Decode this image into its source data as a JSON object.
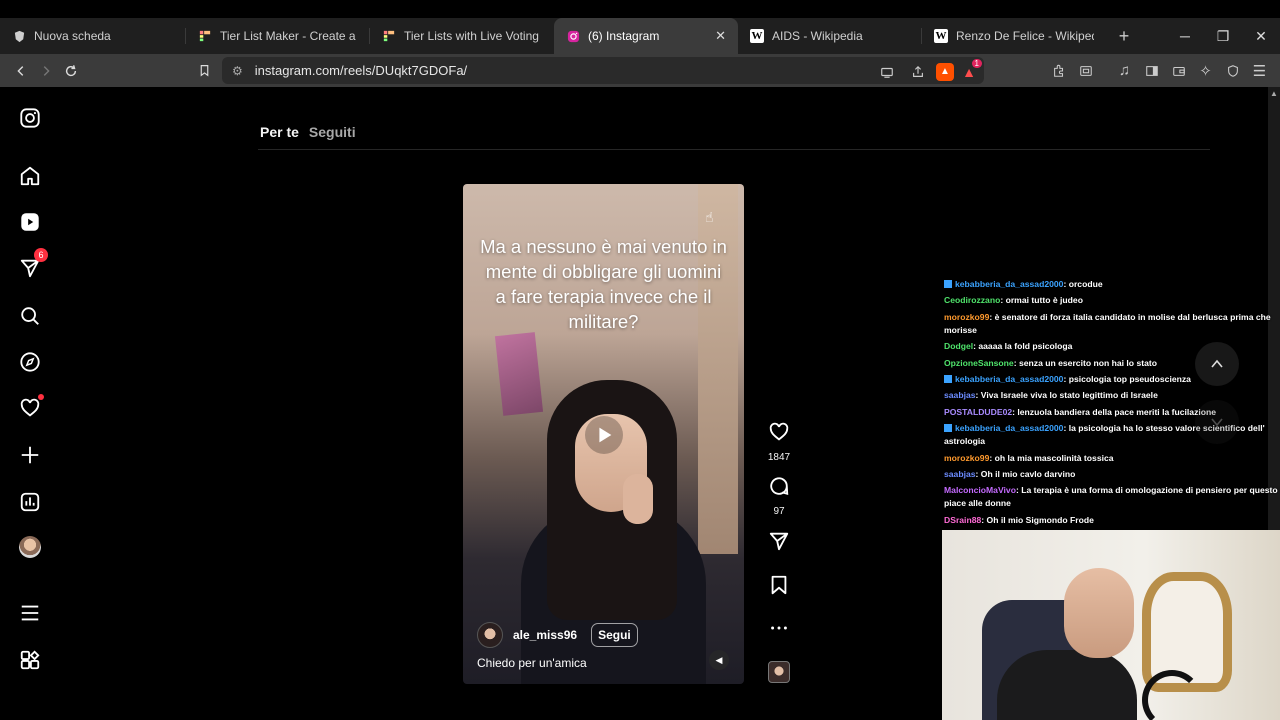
{
  "browser": {
    "tabs": [
      {
        "title": "Nuova scheda",
        "icon": "brave-lion-icon",
        "active": false
      },
      {
        "title": "Tier List Maker - Create a Tier Li",
        "icon": "tiermaker-icon",
        "active": false
      },
      {
        "title": "Tier Lists with Live Voting - TierM",
        "icon": "tiermaker-icon",
        "active": false
      },
      {
        "title": "(6) Instagram",
        "icon": "instagram-icon",
        "active": true
      },
      {
        "title": "AIDS - Wikipedia",
        "icon": "wikipedia-icon",
        "active": false
      },
      {
        "title": "Renzo De Felice - Wikipedia",
        "icon": "wikipedia-icon",
        "active": false
      }
    ],
    "url": "instagram.com/reels/DUqkt7GDOFa/",
    "alert_count": "1"
  },
  "instagram": {
    "nav": {
      "notifications_badge": "6"
    },
    "feed_tabs": {
      "for_you": "Per te",
      "following": "Seguiti"
    },
    "reel": {
      "overlay_text": "Ma a nessuno è mai venuto in mente di obbligare gli uomini a fare terapia invece che il militare?",
      "author": "ale_miss96",
      "follow_label": "Segui",
      "caption": "Chiedo per un'amica",
      "likes": "1847",
      "comments": "97"
    }
  },
  "stream_chat": {
    "messages": [
      {
        "user": "kebabberia_da_assad2000",
        "color": "#3ba3ff",
        "badge": true,
        "text": ": orcodue"
      },
      {
        "user": "Ceodirozzano",
        "color": "#4fe36b",
        "badge": false,
        "text": ": ormai tutto è judeo"
      },
      {
        "user": "morozko99",
        "color": "#ff9a2e",
        "badge": false,
        "text": ": è senatore di forza italia candidato in molise dal berlusca prima che morisse"
      },
      {
        "user": "Dodgel",
        "color": "#4fe36b",
        "badge": false,
        "text": ": aaaaa la fold psicologa"
      },
      {
        "user": "OpzioneSansone",
        "color": "#4fe36b",
        "badge": false,
        "text": ": senza un esercito non hai lo stato"
      },
      {
        "user": "kebabberia_da_assad2000",
        "color": "#3ba3ff",
        "badge": true,
        "text": ": psicologia top pseudoscienza"
      },
      {
        "user": "saabjas",
        "color": "#6c8cff",
        "badge": false,
        "text": ": Viva Israele viva lo stato legittimo di Israele"
      },
      {
        "user": "POSTALDUDE02",
        "color": "#a98bff",
        "badge": false,
        "text": ": lenzuola bandiera della pace meriti la fucilazione"
      },
      {
        "user": "kebabberia_da_assad2000",
        "color": "#3ba3ff",
        "badge": true,
        "text": ": la psicologia ha lo stesso valore scientifico dell' astrologia"
      },
      {
        "user": "morozko99",
        "color": "#ff9a2e",
        "badge": false,
        "text": ": oh la mia mascolinità tossica"
      },
      {
        "user": "saabjas",
        "color": "#6c8cff",
        "badge": false,
        "text": ": Oh il mio cavlo darvino"
      },
      {
        "user": "MalconcioMaVivo",
        "color": "#c56bff",
        "badge": false,
        "text": ": La terapia è una forma di omologazione di pensiero per questo piace alle donne"
      },
      {
        "user": "DSrain88",
        "color": "#ff6bd6",
        "badge": false,
        "text": ": Oh il mio Sigmondo Frode"
      }
    ]
  }
}
